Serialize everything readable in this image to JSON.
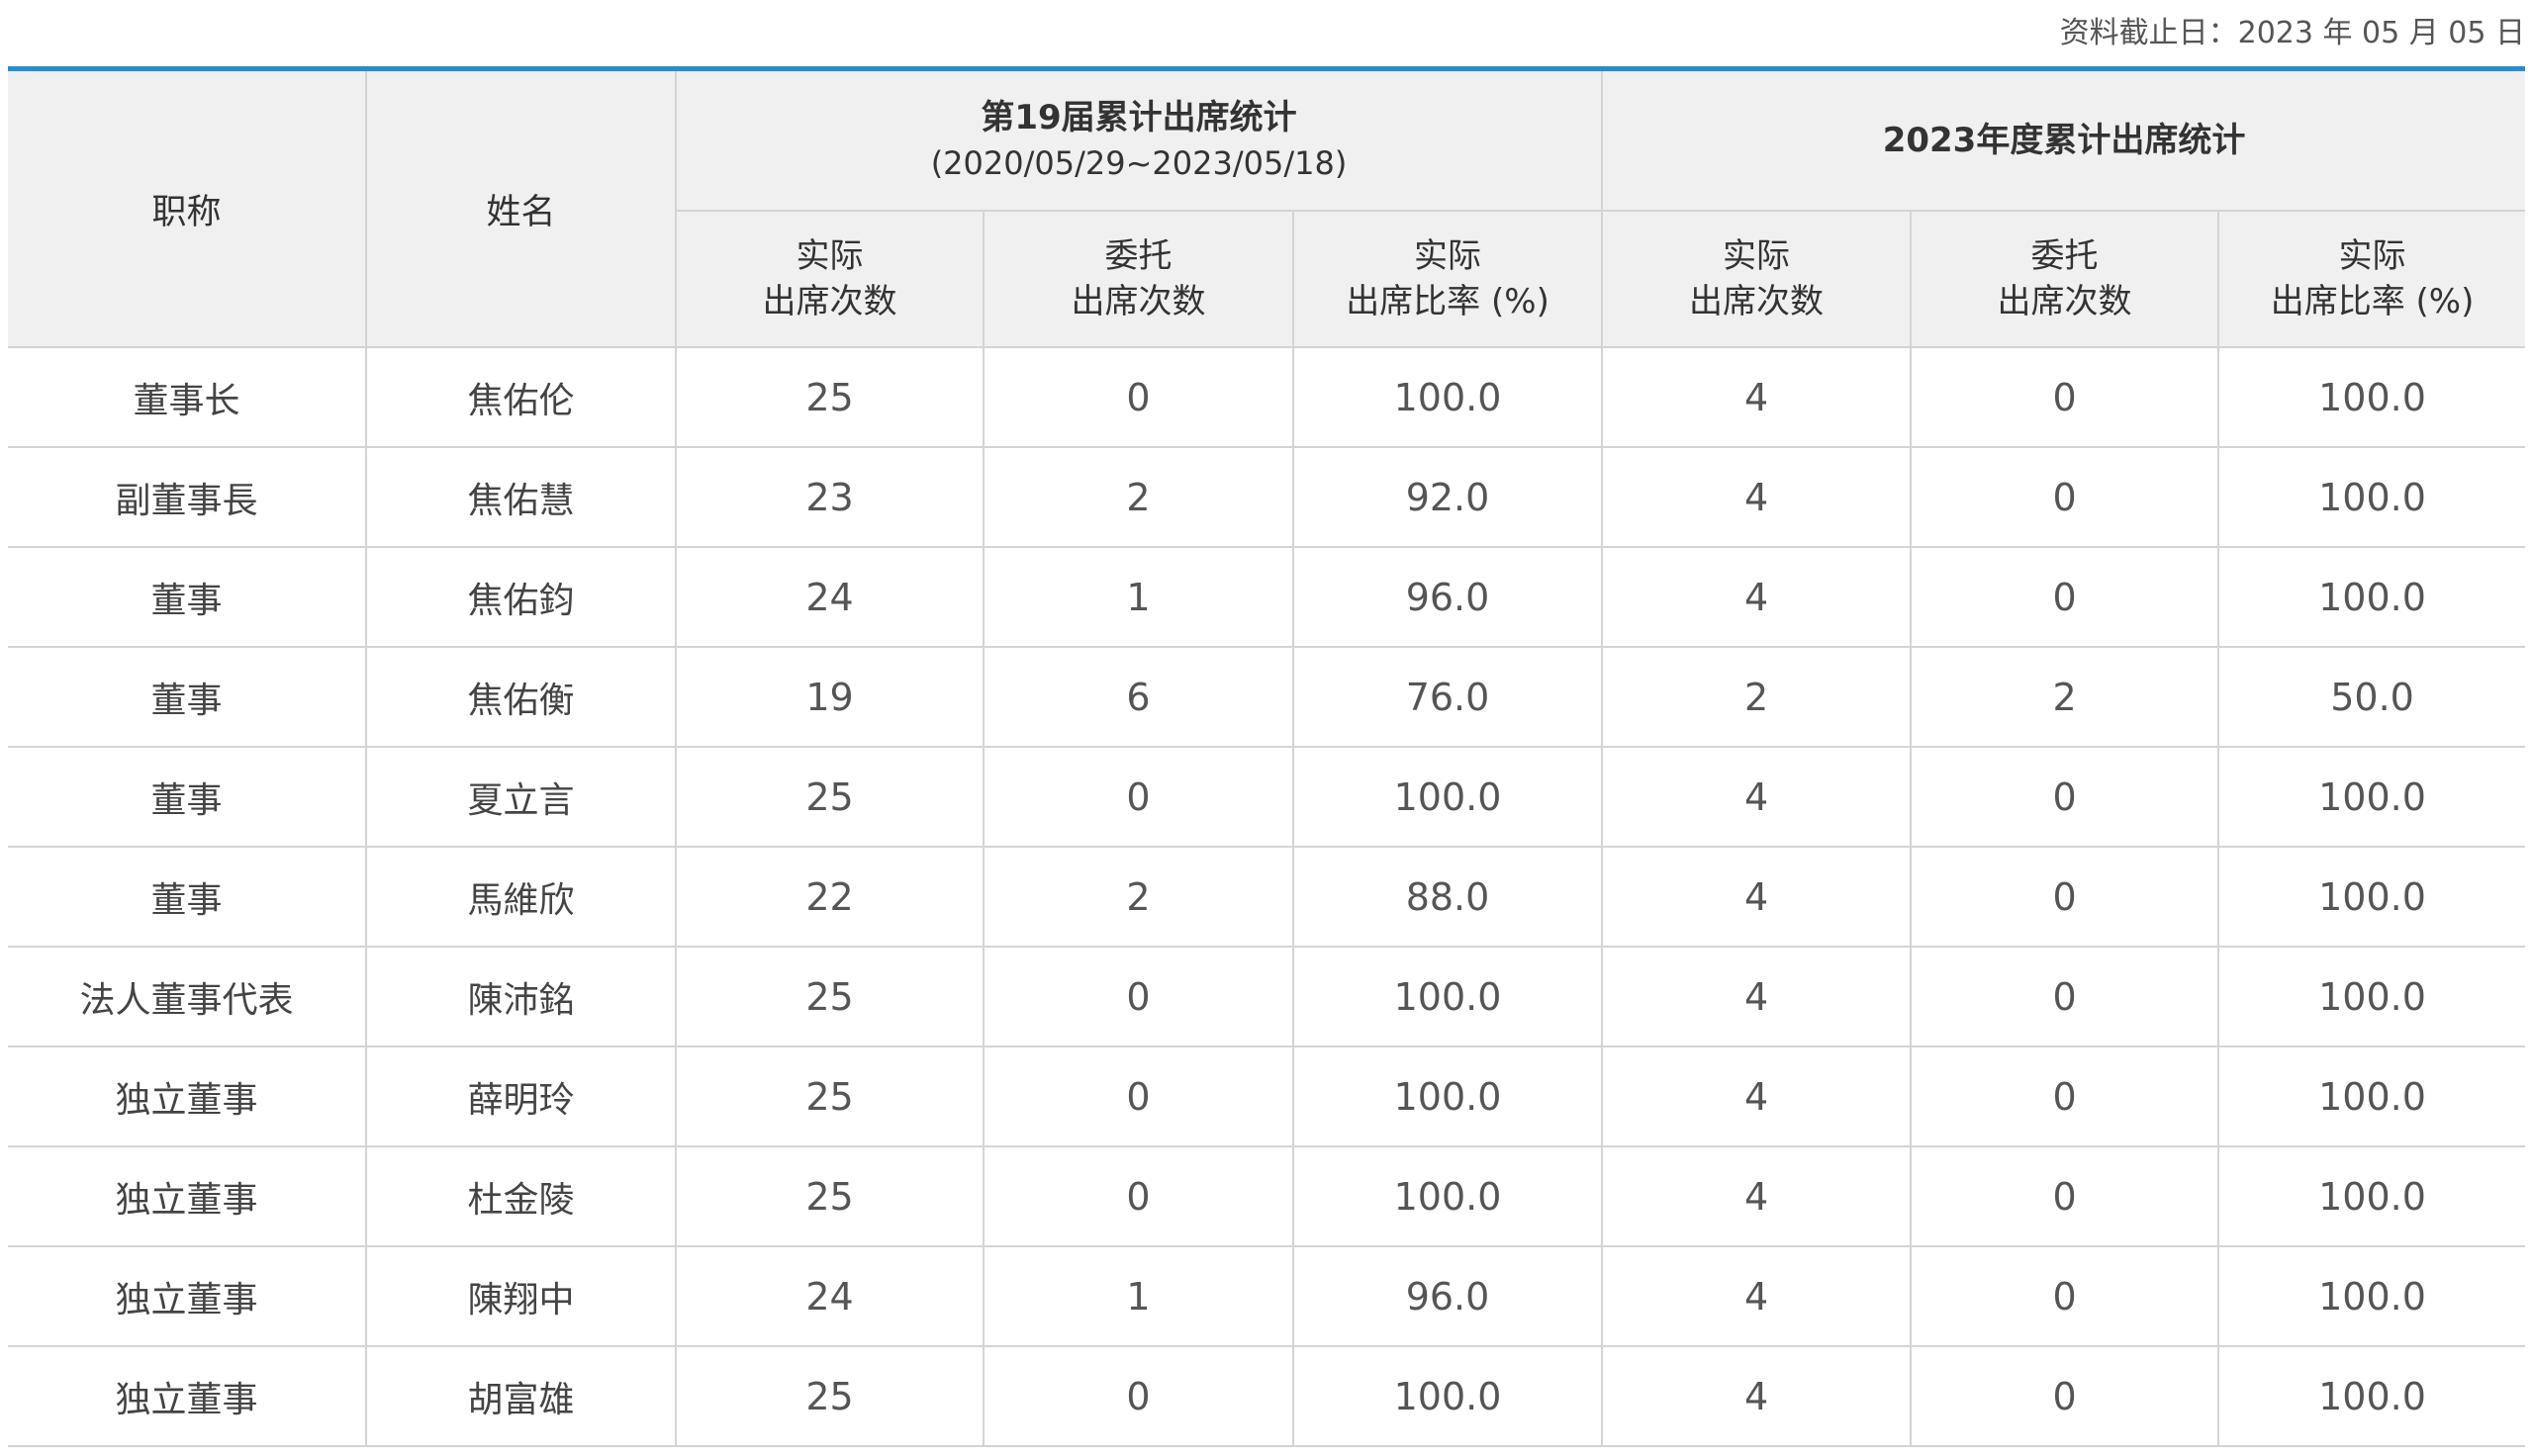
{
  "data_date": {
    "label": "资料截止日：",
    "value": "2023 年 05 月 05 日"
  },
  "colors": {
    "accent_rule": "#2b8ad0",
    "header_bg": "#f0f0f0",
    "border": "#d4d4d4"
  },
  "header": {
    "title_col": "职称",
    "name_col": "姓名",
    "group1": {
      "title": "第19届累计出席统计",
      "period": "(2020/05/29~2023/05/18)"
    },
    "group2": {
      "title": "2023年度累计出席统计"
    },
    "sub": {
      "actual_line1": "实际",
      "actual_line2": "出席次数",
      "proxy_line1": "委托",
      "proxy_line2": "出席次数",
      "rate_line1": "实际",
      "rate_line2": "出席比率 (%)"
    }
  },
  "rows": [
    {
      "title": "董事长",
      "name": "焦佑伦",
      "g1_actual": "25",
      "g1_proxy": "0",
      "g1_rate": "100.0",
      "g2_actual": "4",
      "g2_proxy": "0",
      "g2_rate": "100.0"
    },
    {
      "title": "副董事長",
      "name": "焦佑慧",
      "g1_actual": "23",
      "g1_proxy": "2",
      "g1_rate": "92.0",
      "g2_actual": "4",
      "g2_proxy": "0",
      "g2_rate": "100.0"
    },
    {
      "title": "董事",
      "name": "焦佑鈞",
      "g1_actual": "24",
      "g1_proxy": "1",
      "g1_rate": "96.0",
      "g2_actual": "4",
      "g2_proxy": "0",
      "g2_rate": "100.0"
    },
    {
      "title": "董事",
      "name": "焦佑衡",
      "g1_actual": "19",
      "g1_proxy": "6",
      "g1_rate": "76.0",
      "g2_actual": "2",
      "g2_proxy": "2",
      "g2_rate": "50.0"
    },
    {
      "title": "董事",
      "name": "夏立言",
      "g1_actual": "25",
      "g1_proxy": "0",
      "g1_rate": "100.0",
      "g2_actual": "4",
      "g2_proxy": "0",
      "g2_rate": "100.0"
    },
    {
      "title": "董事",
      "name": "馬維欣",
      "g1_actual": "22",
      "g1_proxy": "2",
      "g1_rate": "88.0",
      "g2_actual": "4",
      "g2_proxy": "0",
      "g2_rate": "100.0"
    },
    {
      "title": "法人董事代表",
      "name": "陳沛銘",
      "g1_actual": "25",
      "g1_proxy": "0",
      "g1_rate": "100.0",
      "g2_actual": "4",
      "g2_proxy": "0",
      "g2_rate": "100.0"
    },
    {
      "title": "独立董事",
      "name": "薛明玲",
      "g1_actual": "25",
      "g1_proxy": "0",
      "g1_rate": "100.0",
      "g2_actual": "4",
      "g2_proxy": "0",
      "g2_rate": "100.0"
    },
    {
      "title": "独立董事",
      "name": "杜金陵",
      "g1_actual": "25",
      "g1_proxy": "0",
      "g1_rate": "100.0",
      "g2_actual": "4",
      "g2_proxy": "0",
      "g2_rate": "100.0"
    },
    {
      "title": "独立董事",
      "name": "陳翔中",
      "g1_actual": "24",
      "g1_proxy": "1",
      "g1_rate": "96.0",
      "g2_actual": "4",
      "g2_proxy": "0",
      "g2_rate": "100.0"
    },
    {
      "title": "独立董事",
      "name": "胡富雄",
      "g1_actual": "25",
      "g1_proxy": "0",
      "g1_rate": "100.0",
      "g2_actual": "4",
      "g2_proxy": "0",
      "g2_rate": "100.0"
    }
  ]
}
